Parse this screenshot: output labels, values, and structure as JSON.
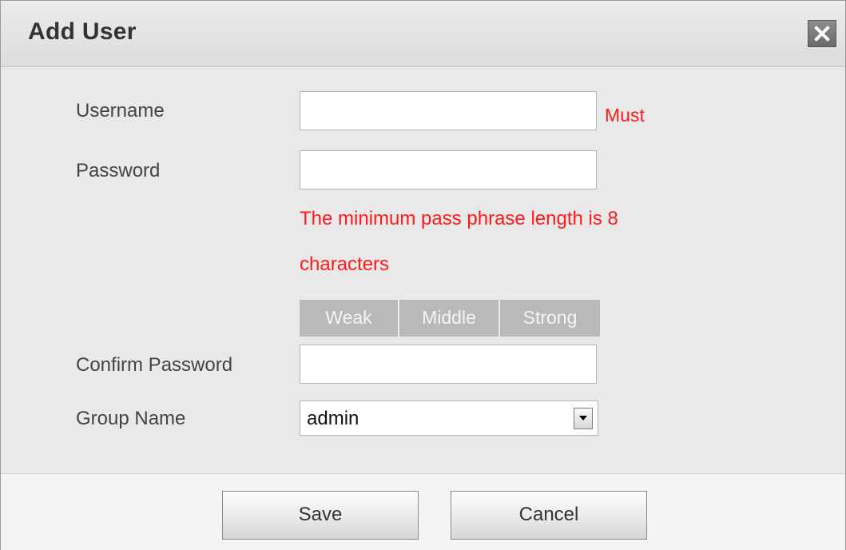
{
  "dialog": {
    "title": "Add User",
    "close_icon": "close-icon"
  },
  "form": {
    "username": {
      "label": "Username",
      "value": "",
      "required_text": "Must"
    },
    "password": {
      "label": "Password",
      "value": "",
      "hint_line1": "The minimum pass phrase length is 8",
      "hint_line2": "characters"
    },
    "strength": {
      "levels": [
        "Weak",
        "Middle",
        "Strong"
      ]
    },
    "confirm_password": {
      "label": "Confirm Password",
      "value": ""
    },
    "group_name": {
      "label": "Group Name",
      "selected": "admin",
      "arrow_icon": "dropdown-arrow-icon"
    }
  },
  "footer": {
    "save_label": "Save",
    "cancel_label": "Cancel"
  },
  "colors": {
    "required_text": "#ff1a1a",
    "strength_bar": "#b9b9b9",
    "dialog_background": "#e9e9e9"
  }
}
